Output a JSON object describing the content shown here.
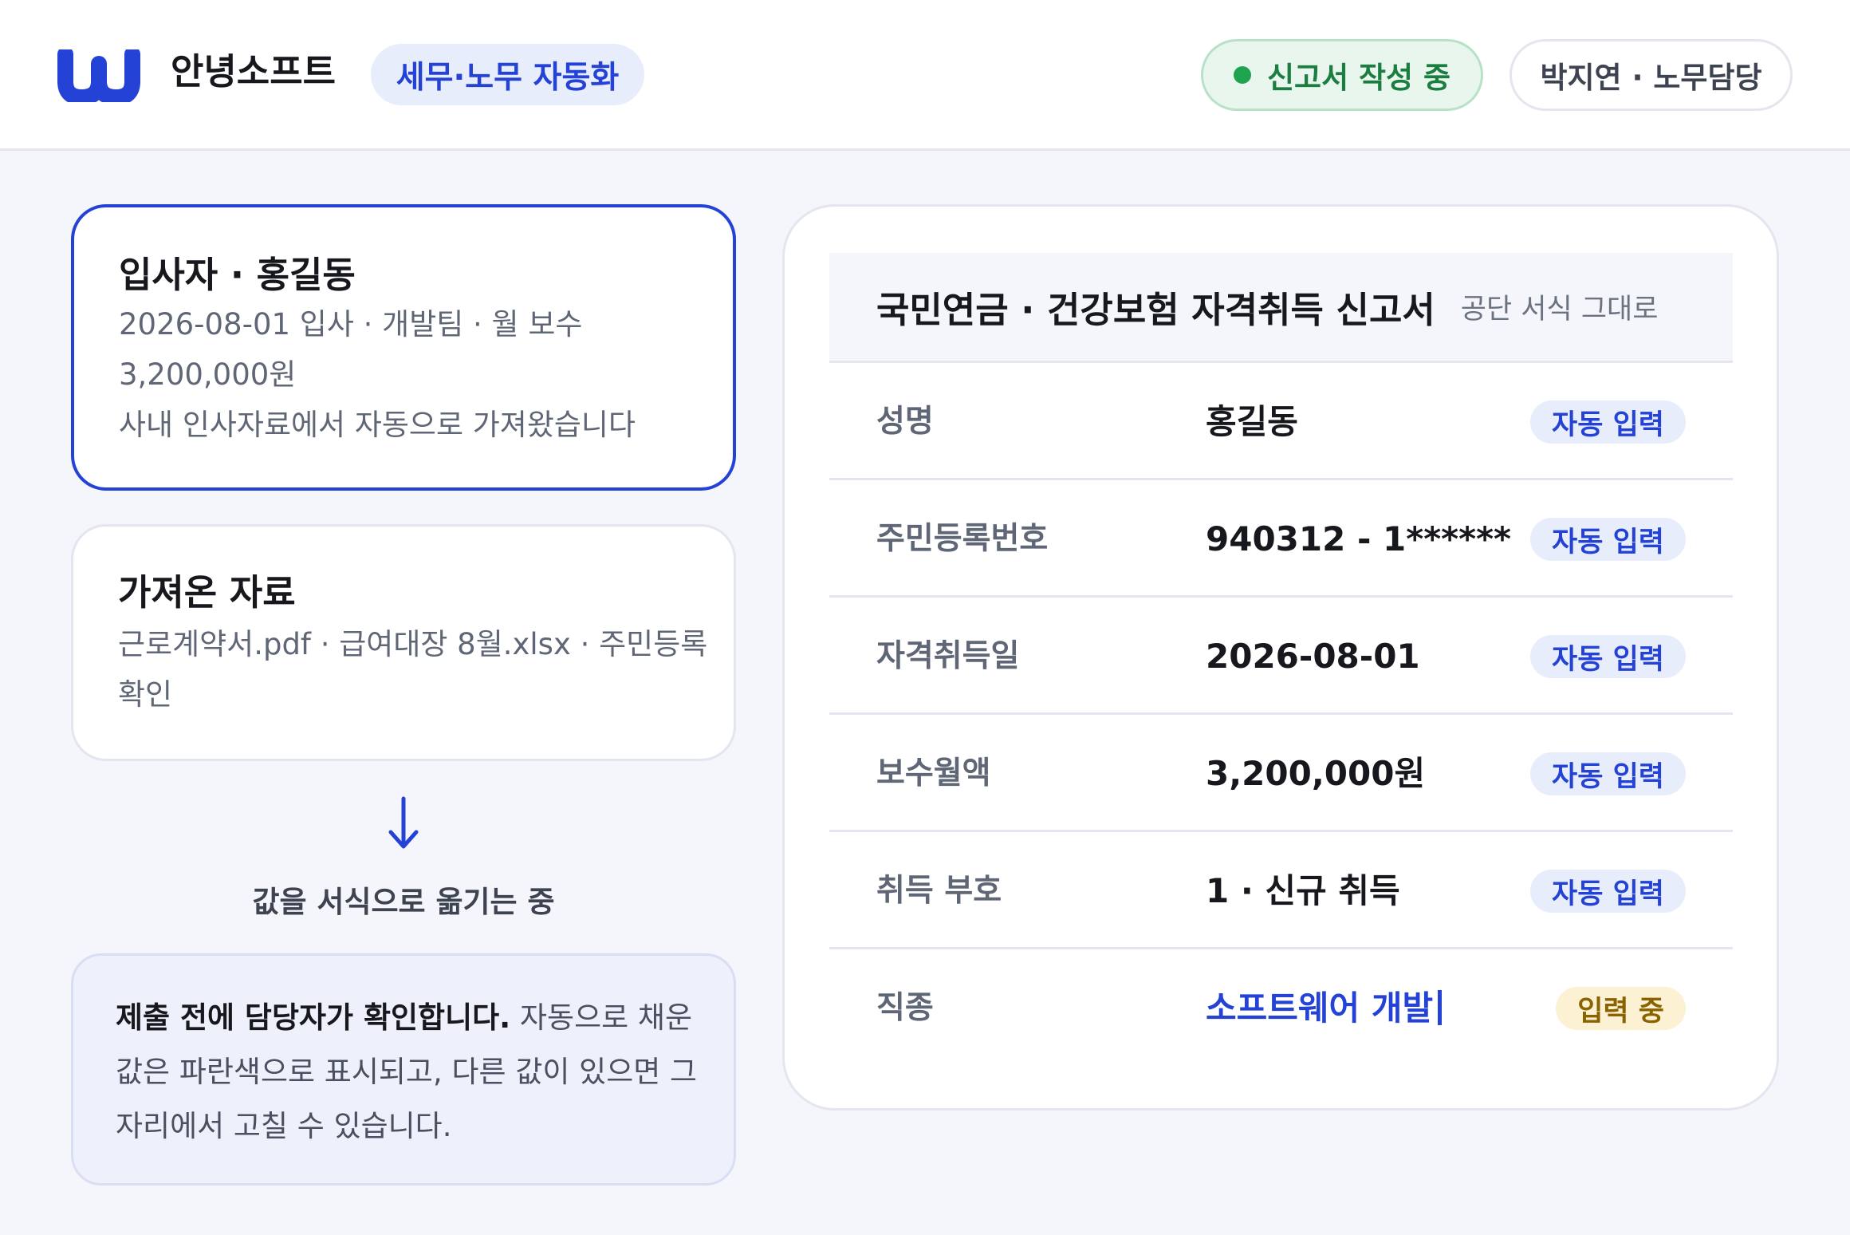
{
  "header": {
    "brand": "안녕소프트",
    "product": "세무·노무 자동화",
    "status": "신고서 작성 중",
    "user": "박지연 · 노무담당",
    "accent": "#2443d6",
    "status_color": "#1fa34f"
  },
  "hire_card": {
    "title": "입사자 · 홍길동",
    "lines": [
      "2026-08-01 입사 · 개발팀 · 월 보수",
      "3,200,000원",
      "사내 인사자료에서 자동으로 가져왔습니다"
    ]
  },
  "source_card": {
    "title": "가져온 자료",
    "lines": [
      "근로계약서.pdf · 급여대장 8월.xlsx · 주민등록",
      "확인"
    ]
  },
  "flow": {
    "arrow_icon": "arrow-down-icon",
    "label": "값을 서식으로 옮기는 중"
  },
  "note": {
    "strong": "제출 전에 담당자가 확인합니다.",
    "text": " 자동으로 채운 값은 파란색으로 표시되고, 다른 값이 있으면 그 자리에서 고칠 수 있습니다."
  },
  "form": {
    "title": "국민연금 · 건강보험 자격취득 신고서",
    "subtitle": "공단 서식 그대로",
    "rows": [
      {
        "label": "성명",
        "value": "홍길동",
        "badge": "자동 입력",
        "state": "auto"
      },
      {
        "label": "주민등록번호",
        "value": "940312 - 1******",
        "badge": "자동 입력",
        "state": "auto"
      },
      {
        "label": "자격취득일",
        "value": "2026-08-01",
        "badge": "자동 입력",
        "state": "auto"
      },
      {
        "label": "보수월액",
        "value": "3,200,000원",
        "badge": "자동 입력",
        "state": "auto"
      },
      {
        "label": "취득 부호",
        "value": "1 · 신규 취득",
        "badge": "자동 입력",
        "state": "auto"
      },
      {
        "label": "직종",
        "value": "소프트웨어 개발",
        "badge": "입력 중",
        "state": "typing"
      }
    ]
  }
}
